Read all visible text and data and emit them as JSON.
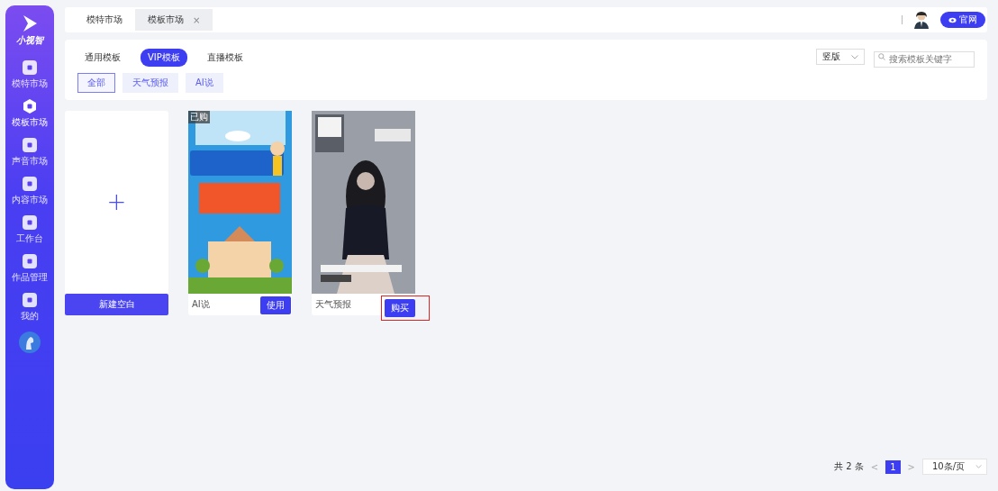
{
  "sidebar": {
    "logo": "小视智",
    "items": [
      {
        "label": "模特市场",
        "selected": false
      },
      {
        "label": "模板市场",
        "selected": true
      },
      {
        "label": "声音市场",
        "selected": false
      },
      {
        "label": "内容市场",
        "selected": false
      },
      {
        "label": "工作台",
        "selected": false
      },
      {
        "label": "作品管理",
        "selected": false
      },
      {
        "label": "我的",
        "selected": false
      }
    ]
  },
  "page_tabs": [
    {
      "label": "模特市场",
      "selected": false,
      "closable": false
    },
    {
      "label": "模板市场",
      "selected": true,
      "closable": true
    }
  ],
  "top_bar": {
    "close_icon": "×",
    "website_button": "官网"
  },
  "category_tabs": [
    {
      "label": "通用模板",
      "selected": false
    },
    {
      "label": "VIP模板",
      "selected": true
    },
    {
      "label": "直播模板",
      "selected": false
    }
  ],
  "filter_tags": [
    {
      "label": "全部",
      "selected": true
    },
    {
      "label": "天气预报",
      "selected": false
    },
    {
      "label": "AI说",
      "selected": false
    }
  ],
  "orientation_select": {
    "value": "竖版"
  },
  "search": {
    "placeholder": "搜索模板关键字"
  },
  "new_card": {
    "plus": "+",
    "button": "新建空白"
  },
  "templates": [
    {
      "name": "AI说",
      "badge": "已购",
      "button": "使用",
      "highlighted": false
    },
    {
      "name": "天气预报",
      "button": "购买",
      "highlighted": true
    }
  ],
  "pagination": {
    "total": "共 2 条",
    "prev": "<",
    "pages": [
      {
        "label": "1",
        "selected": true
      }
    ],
    "next": ">",
    "page_size": "10条/页"
  }
}
